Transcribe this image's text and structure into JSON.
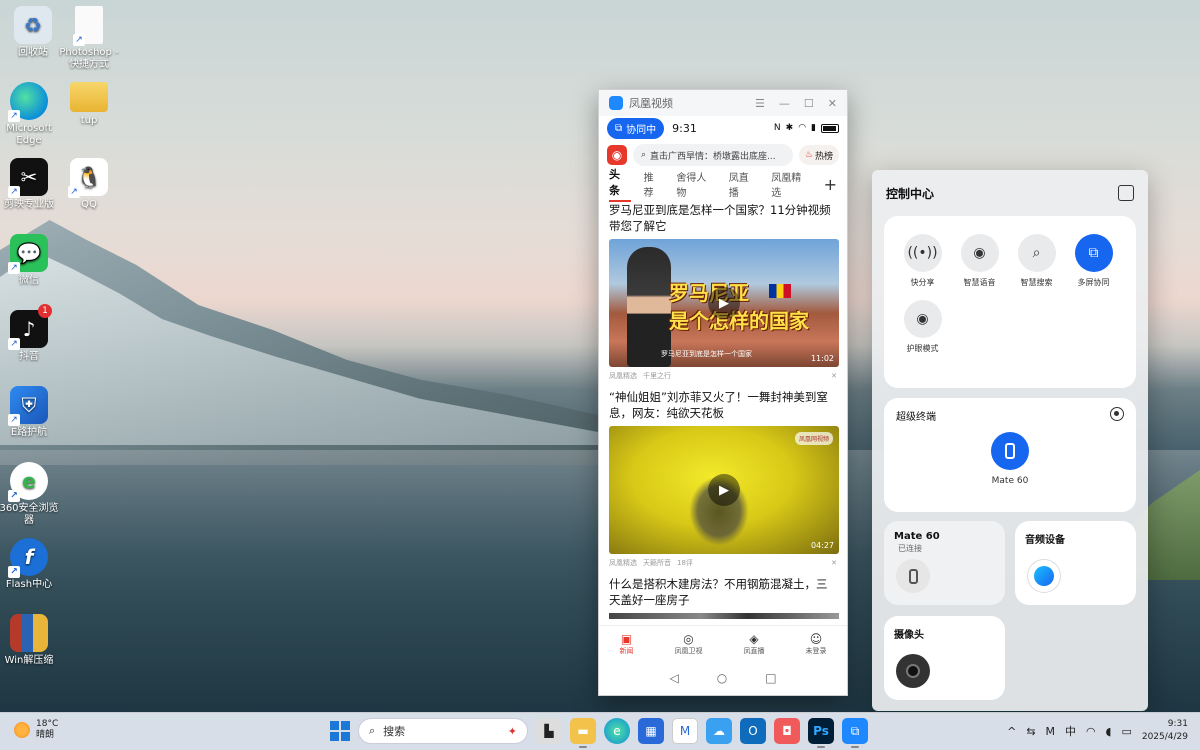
{
  "desktop": {
    "icons": [
      {
        "label": "回收站",
        "icon": "recycle-bin-icon",
        "color": "#9fb5c8"
      },
      {
        "label": "Photoshop - 快捷方式",
        "icon": "file-icon",
        "color": "#ffffff"
      },
      {
        "label": "Microsoft Edge",
        "icon": "edge-icon",
        "color": "#0c8fd8"
      },
      {
        "label": "tup",
        "icon": "folder-icon",
        "color": "#f2c24a"
      },
      {
        "label": "剪映专业版",
        "icon": "capcut-icon",
        "color": "#111111"
      },
      {
        "label": "QQ",
        "icon": "qq-penguin-icon",
        "color": "#ffffff"
      },
      {
        "label": "微信",
        "icon": "wechat-icon",
        "color": "#2bc15a"
      },
      {
        "label": "抖音",
        "icon": "douyin-icon",
        "color": "#111111",
        "badge": "1"
      },
      {
        "label": "E路护航",
        "icon": "shield-icon",
        "color": "#1d6fd6"
      },
      {
        "label": "360安全浏览器",
        "icon": "browser-360-icon",
        "color": "#34b44a"
      },
      {
        "label": "Flash中心",
        "icon": "flash-icon",
        "color": "#1b6fd6"
      },
      {
        "label": "Win解压缩",
        "icon": "winrar-icon",
        "color": "#b43a2a"
      }
    ]
  },
  "phone": {
    "window_title": "凤凰视频",
    "status": {
      "collab": "协同中",
      "time": "9:31"
    },
    "search_placeholder": "直击广西旱情：桥墩露出底座...",
    "hot_label": "热榜",
    "tabs": [
      "头条",
      "推荐",
      "舍得人物",
      "凤直播",
      "凤凰精选"
    ],
    "articles": [
      {
        "title": "罗马尼亚到底是怎样一个国家？11分钟视频带您了解它",
        "overlay": [
          "罗马尼亚",
          "是个怎样的国家"
        ],
        "caption": "罗马尼亚到底是怎样一个国家",
        "duration": "11:02",
        "source": "凤凰精选",
        "channel": "千里之行"
      },
      {
        "title": "“神仙姐姐”刘亦菲又火了！一舞封神美到窒息，网友：纯欲天花板",
        "brand": "凤凰网视频",
        "duration": "04:27",
        "source": "凤凰精选",
        "channel": "天籁所音",
        "comments": "18评"
      },
      {
        "title": "什么是搭积木建房法？不用钢筋混凝土，三天盖好一座房子"
      }
    ],
    "bottom_nav": [
      "新闻",
      "凤凰卫视",
      "凤直播",
      "未登录"
    ]
  },
  "control_center": {
    "title": "控制中心",
    "toggles": [
      {
        "label": "快分享",
        "on": false
      },
      {
        "label": "智慧语音",
        "on": false
      },
      {
        "label": "智慧搜索",
        "on": false
      },
      {
        "label": "多屏协同",
        "on": true
      },
      {
        "label": "护眼模式",
        "on": false
      }
    ],
    "super_device": {
      "title": "超级终端",
      "device": "Mate 60"
    },
    "mate_card": {
      "title": "Mate 60",
      "status": "已连接"
    },
    "audio_card": {
      "title": "音频设备"
    },
    "camera_card": {
      "title": "摄像头"
    },
    "accent": "#1766f0"
  },
  "taskbar": {
    "weather": {
      "temp": "18°C",
      "desc": "晴朗"
    },
    "search_label": "搜索",
    "ime": "中",
    "time": "9:31",
    "date": "2025/4/29"
  }
}
